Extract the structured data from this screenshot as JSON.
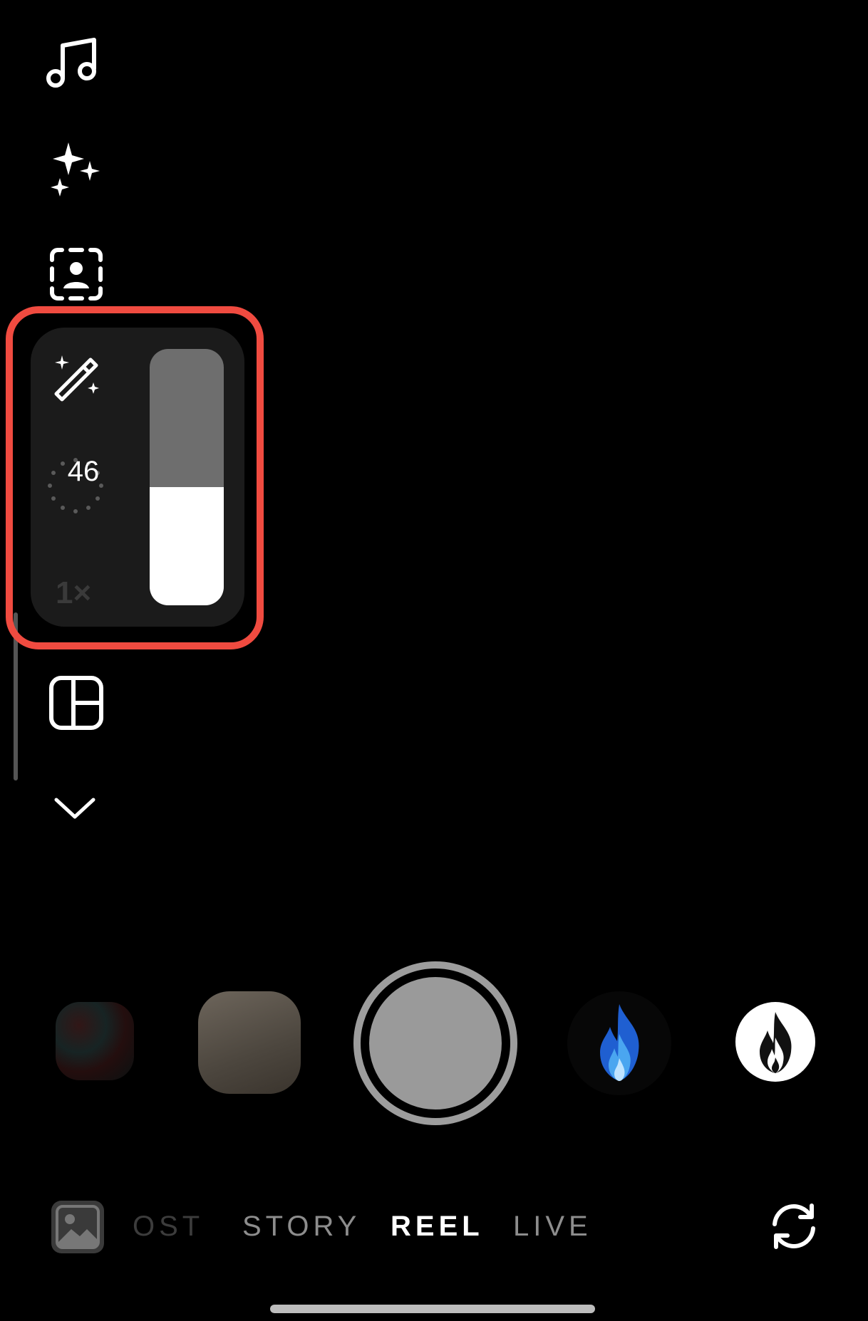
{
  "left_rail": {
    "icons": [
      "music-icon",
      "sparkles-icon",
      "person-frame-icon",
      "magic-wand-icon",
      "layout-icon",
      "chevron-down-icon"
    ]
  },
  "beauty_panel": {
    "intensity_value": "46",
    "intensity_fraction": 0.46,
    "zoom_label": "1×",
    "highlight_color": "#f04b40"
  },
  "effects": [
    "effect-pattern",
    "effect-blur",
    "effect-blue-flame",
    "effect-white-flame"
  ],
  "modes": {
    "post": "OST",
    "story": "STORY",
    "reel": "REEL",
    "live": "LIVE",
    "active": "REEL"
  },
  "colors": {
    "background": "#000000",
    "active_mode": "#ffffff",
    "inactive_mode": "#8d8d8d"
  }
}
